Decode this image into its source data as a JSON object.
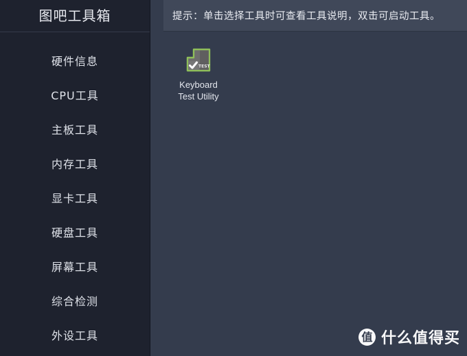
{
  "app": {
    "title": "图吧工具箱"
  },
  "sidebar": {
    "items": [
      {
        "label": "硬件信息",
        "name": "sidebar-item-hardware-info"
      },
      {
        "label": "CPU工具",
        "name": "sidebar-item-cpu-tools"
      },
      {
        "label": "主板工具",
        "name": "sidebar-item-motherboard-tools"
      },
      {
        "label": "内存工具",
        "name": "sidebar-item-memory-tools"
      },
      {
        "label": "显卡工具",
        "name": "sidebar-item-gpu-tools"
      },
      {
        "label": "硬盘工具",
        "name": "sidebar-item-disk-tools"
      },
      {
        "label": "屏幕工具",
        "name": "sidebar-item-screen-tools"
      },
      {
        "label": "综合检测",
        "name": "sidebar-item-comprehensive-test"
      },
      {
        "label": "外设工具",
        "name": "sidebar-item-peripheral-tools"
      }
    ]
  },
  "content": {
    "tip": "提示：单击选择工具时可查看工具说明，双击可启动工具。",
    "tools": [
      {
        "label_line1": "Keyboard",
        "label_line2": "Test Utility",
        "icon": "keyboard-test-icon",
        "icon_badge_text": "TEST"
      }
    ]
  },
  "watermark": {
    "logo_text": "值",
    "text": "什么值得买"
  },
  "colors": {
    "sidebar_bg": "#1e222e",
    "content_bg": "#343c4d",
    "tip_bar_bg": "#404859",
    "text_primary": "#e8eaf0",
    "icon_outline_green": "#8fbf5a",
    "icon_fill_grey": "#6e6e6e"
  }
}
